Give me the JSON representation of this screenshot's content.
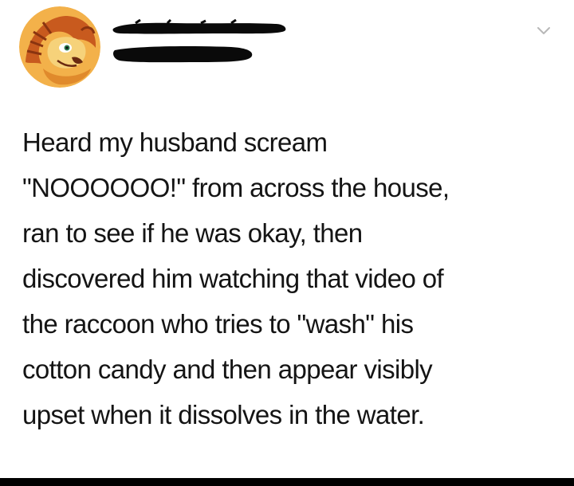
{
  "post": {
    "author": {
      "avatar_icon": "lion-avatar-icon",
      "name_redacted": true,
      "handle_redacted": true
    },
    "menu_icon": "chevron-down-icon",
    "text_lines": [
      "Heard my husband scream",
      "\"NOOOOOO!\" from across the house,",
      "ran to see if he was okay, then",
      "discovered him watching that video of",
      "the raccoon who tries to \"wash\" his",
      "cotton candy and then appear visibly",
      "upset when it dissolves in the water."
    ]
  },
  "colors": {
    "text": "#141414",
    "redaction": "#0a0a0a",
    "chevron": "#b8b8b8",
    "avatar_bg": "#f3b14a",
    "avatar_mane": "#c85a1e",
    "bottom_bar": "#000000"
  }
}
